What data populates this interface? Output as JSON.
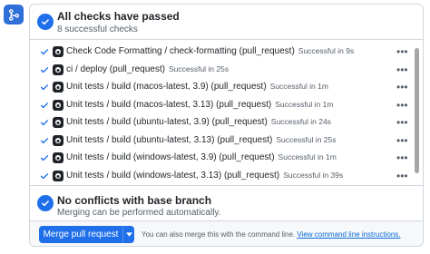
{
  "header": {
    "title": "All checks have passed",
    "subtitle": "8 successful checks"
  },
  "checks": [
    {
      "name": "Check Code Formatting / check-formatting (pull_request)",
      "status": "Successful in 9s"
    },
    {
      "name": "ci / deploy (pull_request)",
      "status": "Successful in 25s"
    },
    {
      "name": "Unit tests / build (macos-latest, 3.9) (pull_request)",
      "status": "Successful in 1m"
    },
    {
      "name": "Unit tests / build (macos-latest, 3.13) (pull_request)",
      "status": "Successful in 1m"
    },
    {
      "name": "Unit tests / build (ubuntu-latest, 3.9) (pull_request)",
      "status": "Successful in 24s"
    },
    {
      "name": "Unit tests / build (ubuntu-latest, 3.13) (pull_request)",
      "status": "Successful in 25s"
    },
    {
      "name": "Unit tests / build (windows-latest, 3.9) (pull_request)",
      "status": "Successful in 1m"
    },
    {
      "name": "Unit tests / build (windows-latest, 3.13) (pull_request)",
      "status": "Successful in 39s"
    }
  ],
  "conflicts": {
    "title": "No conflicts with base branch",
    "subtitle": "Merging can be performed automatically."
  },
  "merge": {
    "button_label": "Merge pull request",
    "note": "You can also merge this with the command line.",
    "link_label": "View command line instructions."
  },
  "icons": {
    "side": "git-merge-icon",
    "check": "check-icon",
    "app": "github-app-icon",
    "kebab": "kebab-horizontal-icon",
    "caret": "triangle-down-icon"
  },
  "colors": {
    "accent": "#1f6feb",
    "side_icon": "#2f6fd8",
    "link": "#0969da",
    "muted": "#57606a",
    "border": "#d0d7de"
  }
}
